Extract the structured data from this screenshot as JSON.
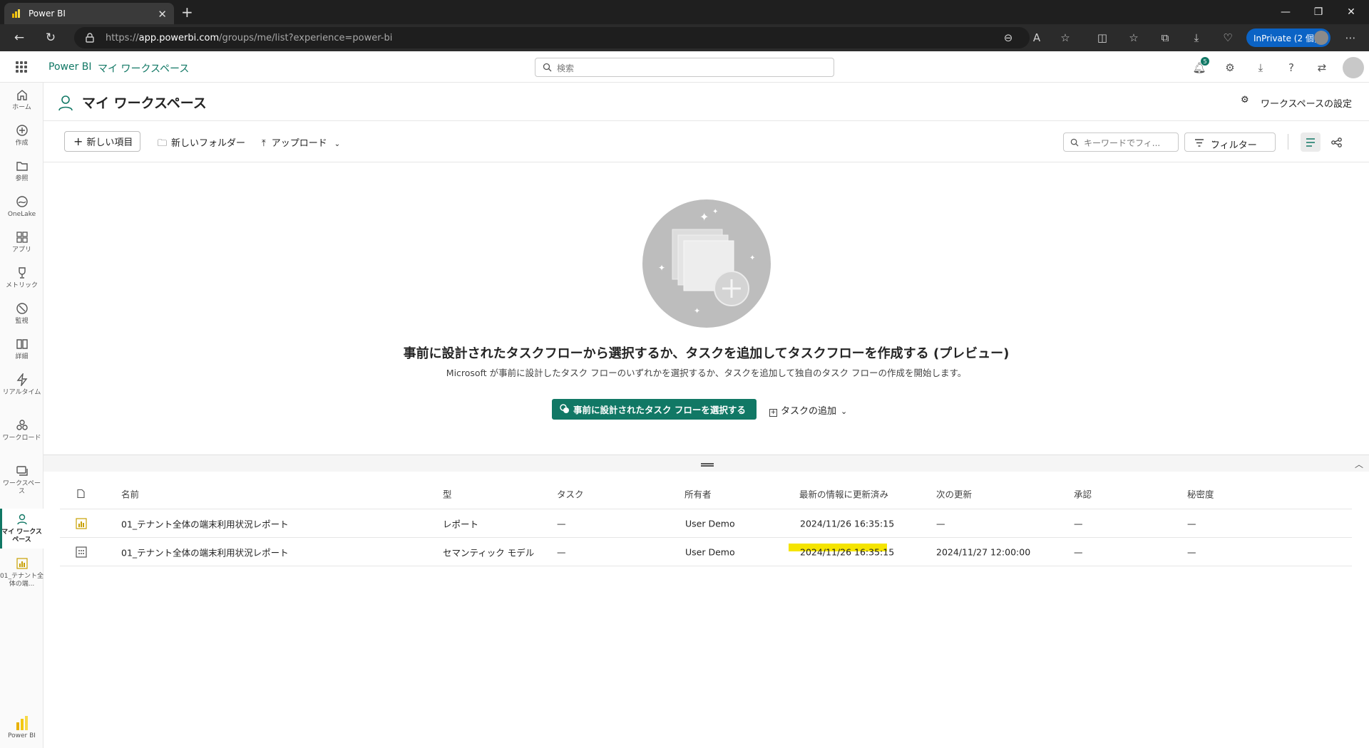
{
  "browser": {
    "tab_title": "Power BI",
    "url_prefix": "https://",
    "url_domain": "app.powerbi.com",
    "url_path": "/groups/me/list?experience=power-bi",
    "inprivate_label": "InPrivate (2 個)"
  },
  "appbar": {
    "brand": "Power BI",
    "breadcrumb": "マイ ワークスペース",
    "search_placeholder": "検索",
    "notification_count": "5"
  },
  "leftnav": {
    "items": [
      {
        "label": "ホーム",
        "icon": "home-icon"
      },
      {
        "label": "作成",
        "icon": "create-icon"
      },
      {
        "label": "参照",
        "icon": "browse-icon"
      },
      {
        "label": "OneLake",
        "icon": "onelake-icon"
      },
      {
        "label": "アプリ",
        "icon": "apps-icon"
      },
      {
        "label": "メトリック",
        "icon": "metrics-icon"
      },
      {
        "label": "監視",
        "icon": "monitor-icon"
      },
      {
        "label": "詳細",
        "icon": "learn-icon"
      },
      {
        "label": "リアルタイム",
        "icon": "realtime-icon"
      },
      {
        "label": "ワークロード",
        "icon": "workload-icon"
      },
      {
        "label": "ワークスペース",
        "icon": "workspaces-icon"
      },
      {
        "label": "マイ ワークスペース",
        "icon": "my-workspace-icon"
      },
      {
        "label": "01_テナント全体の端...",
        "icon": "report-icon"
      }
    ],
    "footer_label": "Power BI"
  },
  "workspace": {
    "title": "マイ ワークスペース",
    "settings_label": "ワークスペースの設定"
  },
  "toolbar": {
    "new_item": "新しい項目",
    "new_folder": "新しいフォルダー",
    "upload": "アップロード",
    "keyword_placeholder": "キーワードでフィ...",
    "filter": "フィルター"
  },
  "empty_state": {
    "title": "事前に設計されたタスクフローから選択するか、タスクを追加してタスクフローを作成する (プレビュー)",
    "subtitle": "Microsoft が事前に設計したタスク フローのいずれかを選択するか、タスクを追加して独自のタスク フローの作成を開始します。",
    "primary_button": "事前に設計されたタスク フローを選択する",
    "add_task": "タスクの追加"
  },
  "table": {
    "headers": [
      "名前",
      "型",
      "タスク",
      "所有者",
      "最新の情報に更新済み",
      "次の更新",
      "承認",
      "秘密度"
    ],
    "rows": [
      {
        "name": "01_テナント全体の端末利用状況レポート",
        "type": "レポート",
        "task": "—",
        "owner": "User Demo",
        "refreshed": "2024/11/26 16:35:15",
        "next": "—",
        "endorsement": "—",
        "sensitivity": "—",
        "icon": "report-icon"
      },
      {
        "name": "01_テナント全体の端末利用状況レポート",
        "type": "セマンティック モデル",
        "task": "—",
        "owner": "User Demo",
        "refreshed": "2024/11/26 16:35:15",
        "next": "2024/11/27 12:00:00",
        "endorsement": "—",
        "sensitivity": "—",
        "icon": "semantic-model-icon"
      }
    ]
  },
  "colors": {
    "accent": "#117865",
    "highlight": "#f5e400"
  }
}
